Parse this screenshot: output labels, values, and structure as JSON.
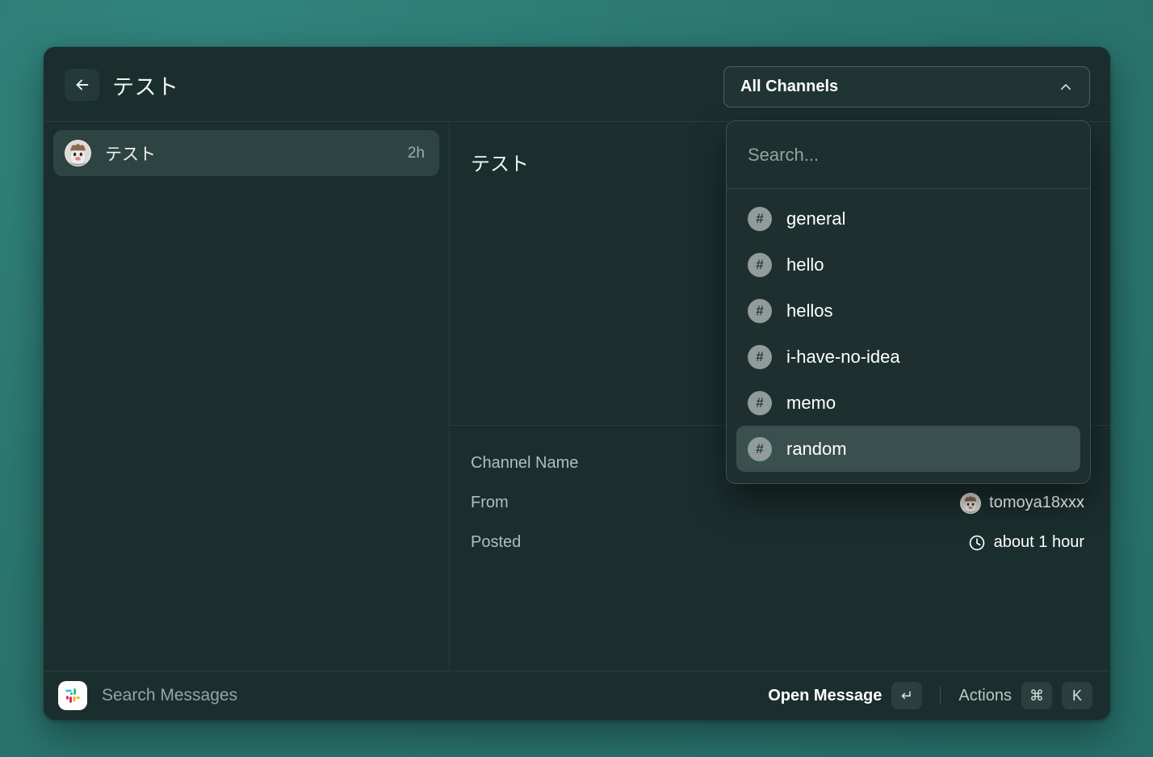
{
  "colors": {
    "desktop_bg": "#2c7771",
    "window_bg": "#1b2e2e",
    "panel_bg": "#1d302f",
    "selected_row": "#2d4442",
    "menu_active": "#3a504e",
    "text_primary": "#ffffff",
    "text_muted": "#9db0ae",
    "border": "#2a3e3d"
  },
  "header": {
    "back_icon": "arrow-left-icon",
    "title": "テスト",
    "channel_filter": {
      "selected_label": "All Channels",
      "chevron_icon": "chevron-up-icon",
      "expanded": true
    }
  },
  "channel_menu": {
    "search": {
      "value": "",
      "placeholder": "Search..."
    },
    "items": [
      {
        "label": "general",
        "icon": "hash-icon",
        "active": false
      },
      {
        "label": "hello",
        "icon": "hash-icon",
        "active": false
      },
      {
        "label": "hellos",
        "icon": "hash-icon",
        "active": false
      },
      {
        "label": "i-have-no-idea",
        "icon": "hash-icon",
        "active": false
      },
      {
        "label": "memo",
        "icon": "hash-icon",
        "active": false
      },
      {
        "label": "random",
        "icon": "hash-icon",
        "active": true
      }
    ]
  },
  "message_list": {
    "items": [
      {
        "avatar": "user-avatar",
        "title": "テスト",
        "time": "2h",
        "selected": true
      }
    ]
  },
  "detail": {
    "preview_text": "テスト",
    "fields": [
      {
        "label": "Channel Name",
        "value": "",
        "icon": ""
      },
      {
        "label": "From",
        "value": "tomoya18xxx",
        "icon": "user-avatar"
      },
      {
        "label": "Posted",
        "value": "about 1 hour",
        "icon": "clock-icon"
      }
    ]
  },
  "footer": {
    "app_icon": "slack-icon",
    "hint": "Search Messages",
    "primary_action": {
      "label": "Open Message",
      "key": "↵"
    },
    "secondary_action": {
      "label": "Actions",
      "keys": [
        "⌘",
        "K"
      ]
    }
  }
}
